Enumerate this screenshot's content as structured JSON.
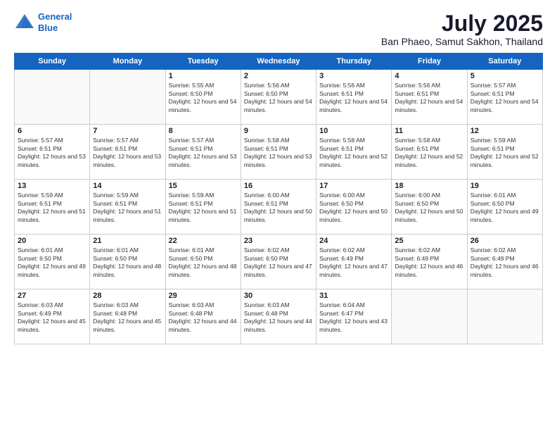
{
  "header": {
    "logo_line1": "General",
    "logo_line2": "Blue",
    "title": "July 2025",
    "subtitle": "Ban Phaeo, Samut Sakhon, Thailand"
  },
  "days_of_week": [
    "Sunday",
    "Monday",
    "Tuesday",
    "Wednesday",
    "Thursday",
    "Friday",
    "Saturday"
  ],
  "weeks": [
    [
      {
        "day": "",
        "sunrise": "",
        "sunset": "",
        "daylight": ""
      },
      {
        "day": "",
        "sunrise": "",
        "sunset": "",
        "daylight": ""
      },
      {
        "day": "1",
        "sunrise": "Sunrise: 5:55 AM",
        "sunset": "Sunset: 6:50 PM",
        "daylight": "Daylight: 12 hours and 54 minutes."
      },
      {
        "day": "2",
        "sunrise": "Sunrise: 5:56 AM",
        "sunset": "Sunset: 6:50 PM",
        "daylight": "Daylight: 12 hours and 54 minutes."
      },
      {
        "day": "3",
        "sunrise": "Sunrise: 5:56 AM",
        "sunset": "Sunset: 6:51 PM",
        "daylight": "Daylight: 12 hours and 54 minutes."
      },
      {
        "day": "4",
        "sunrise": "Sunrise: 5:56 AM",
        "sunset": "Sunset: 6:51 PM",
        "daylight": "Daylight: 12 hours and 54 minutes."
      },
      {
        "day": "5",
        "sunrise": "Sunrise: 5:57 AM",
        "sunset": "Sunset: 6:51 PM",
        "daylight": "Daylight: 12 hours and 54 minutes."
      }
    ],
    [
      {
        "day": "6",
        "sunrise": "Sunrise: 5:57 AM",
        "sunset": "Sunset: 6:51 PM",
        "daylight": "Daylight: 12 hours and 53 minutes."
      },
      {
        "day": "7",
        "sunrise": "Sunrise: 5:57 AM",
        "sunset": "Sunset: 6:51 PM",
        "daylight": "Daylight: 12 hours and 53 minutes."
      },
      {
        "day": "8",
        "sunrise": "Sunrise: 5:57 AM",
        "sunset": "Sunset: 6:51 PM",
        "daylight": "Daylight: 12 hours and 53 minutes."
      },
      {
        "day": "9",
        "sunrise": "Sunrise: 5:58 AM",
        "sunset": "Sunset: 6:51 PM",
        "daylight": "Daylight: 12 hours and 53 minutes."
      },
      {
        "day": "10",
        "sunrise": "Sunrise: 5:58 AM",
        "sunset": "Sunset: 6:51 PM",
        "daylight": "Daylight: 12 hours and 52 minutes."
      },
      {
        "day": "11",
        "sunrise": "Sunrise: 5:58 AM",
        "sunset": "Sunset: 6:51 PM",
        "daylight": "Daylight: 12 hours and 52 minutes."
      },
      {
        "day": "12",
        "sunrise": "Sunrise: 5:59 AM",
        "sunset": "Sunset: 6:51 PM",
        "daylight": "Daylight: 12 hours and 52 minutes."
      }
    ],
    [
      {
        "day": "13",
        "sunrise": "Sunrise: 5:59 AM",
        "sunset": "Sunset: 6:51 PM",
        "daylight": "Daylight: 12 hours and 51 minutes."
      },
      {
        "day": "14",
        "sunrise": "Sunrise: 5:59 AM",
        "sunset": "Sunset: 6:51 PM",
        "daylight": "Daylight: 12 hours and 51 minutes."
      },
      {
        "day": "15",
        "sunrise": "Sunrise: 5:59 AM",
        "sunset": "Sunset: 6:51 PM",
        "daylight": "Daylight: 12 hours and 51 minutes."
      },
      {
        "day": "16",
        "sunrise": "Sunrise: 6:00 AM",
        "sunset": "Sunset: 6:51 PM",
        "daylight": "Daylight: 12 hours and 50 minutes."
      },
      {
        "day": "17",
        "sunrise": "Sunrise: 6:00 AM",
        "sunset": "Sunset: 6:50 PM",
        "daylight": "Daylight: 12 hours and 50 minutes."
      },
      {
        "day": "18",
        "sunrise": "Sunrise: 6:00 AM",
        "sunset": "Sunset: 6:50 PM",
        "daylight": "Daylight: 12 hours and 50 minutes."
      },
      {
        "day": "19",
        "sunrise": "Sunrise: 6:01 AM",
        "sunset": "Sunset: 6:50 PM",
        "daylight": "Daylight: 12 hours and 49 minutes."
      }
    ],
    [
      {
        "day": "20",
        "sunrise": "Sunrise: 6:01 AM",
        "sunset": "Sunset: 6:50 PM",
        "daylight": "Daylight: 12 hours and 49 minutes."
      },
      {
        "day": "21",
        "sunrise": "Sunrise: 6:01 AM",
        "sunset": "Sunset: 6:50 PM",
        "daylight": "Daylight: 12 hours and 48 minutes."
      },
      {
        "day": "22",
        "sunrise": "Sunrise: 6:01 AM",
        "sunset": "Sunset: 6:50 PM",
        "daylight": "Daylight: 12 hours and 48 minutes."
      },
      {
        "day": "23",
        "sunrise": "Sunrise: 6:02 AM",
        "sunset": "Sunset: 6:50 PM",
        "daylight": "Daylight: 12 hours and 47 minutes."
      },
      {
        "day": "24",
        "sunrise": "Sunrise: 6:02 AM",
        "sunset": "Sunset: 6:49 PM",
        "daylight": "Daylight: 12 hours and 47 minutes."
      },
      {
        "day": "25",
        "sunrise": "Sunrise: 6:02 AM",
        "sunset": "Sunset: 6:49 PM",
        "daylight": "Daylight: 12 hours and 46 minutes."
      },
      {
        "day": "26",
        "sunrise": "Sunrise: 6:02 AM",
        "sunset": "Sunset: 6:49 PM",
        "daylight": "Daylight: 12 hours and 46 minutes."
      }
    ],
    [
      {
        "day": "27",
        "sunrise": "Sunrise: 6:03 AM",
        "sunset": "Sunset: 6:49 PM",
        "daylight": "Daylight: 12 hours and 45 minutes."
      },
      {
        "day": "28",
        "sunrise": "Sunrise: 6:03 AM",
        "sunset": "Sunset: 6:48 PM",
        "daylight": "Daylight: 12 hours and 45 minutes."
      },
      {
        "day": "29",
        "sunrise": "Sunrise: 6:03 AM",
        "sunset": "Sunset: 6:48 PM",
        "daylight": "Daylight: 12 hours and 44 minutes."
      },
      {
        "day": "30",
        "sunrise": "Sunrise: 6:03 AM",
        "sunset": "Sunset: 6:48 PM",
        "daylight": "Daylight: 12 hours and 44 minutes."
      },
      {
        "day": "31",
        "sunrise": "Sunrise: 6:04 AM",
        "sunset": "Sunset: 6:47 PM",
        "daylight": "Daylight: 12 hours and 43 minutes."
      },
      {
        "day": "",
        "sunrise": "",
        "sunset": "",
        "daylight": ""
      },
      {
        "day": "",
        "sunrise": "",
        "sunset": "",
        "daylight": ""
      }
    ]
  ]
}
